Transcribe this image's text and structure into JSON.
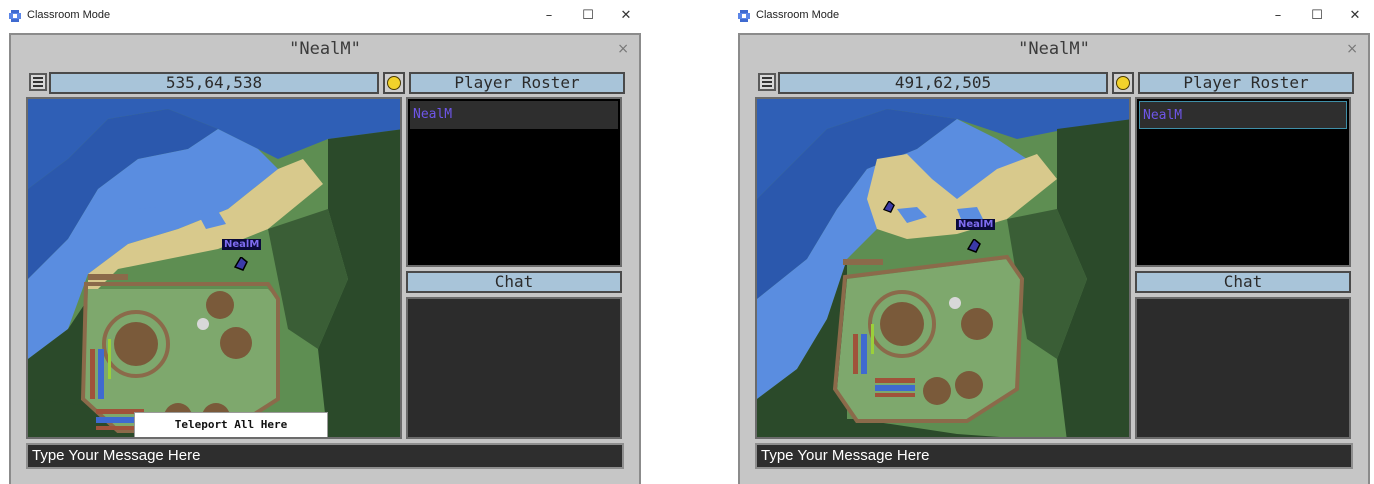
{
  "app": {
    "window_title": "Classroom Mode",
    "minimize_glyph": "–",
    "maximize_glyph": "☐",
    "close_glyph": "✕"
  },
  "panels": [
    {
      "dialog_title": "\"NealM\"",
      "dialog_close": "×",
      "coordinates": "535,64,538",
      "roster_header": "Player Roster",
      "roster_items": [
        "NealM"
      ],
      "chat_header": "Chat",
      "message_placeholder": "Type Your Message Here",
      "map_player_label": "NealM",
      "context_menu_item": "Teleport All Here"
    },
    {
      "dialog_title": "\"NealM\"",
      "dialog_close": "×",
      "coordinates": "491,62,505",
      "roster_header": "Player Roster",
      "roster_items": [
        "NealM"
      ],
      "chat_header": "Chat",
      "message_placeholder": "Type Your Message Here",
      "map_player_label": "NealM"
    }
  ],
  "colors": {
    "player_name": "#6e56e8",
    "header_bg": "#a8c4d9",
    "water_deep": "#2f5fb6",
    "water_shallow": "#5a8de0",
    "sand": "#d8c98c",
    "grass": "#6e9a5f",
    "forest": "#2b4a2a",
    "path": "#8b6a4a"
  },
  "icons": [
    "app-icon",
    "menu-icon",
    "face-icon",
    "player-marker-icon",
    "chicken-icon"
  ]
}
